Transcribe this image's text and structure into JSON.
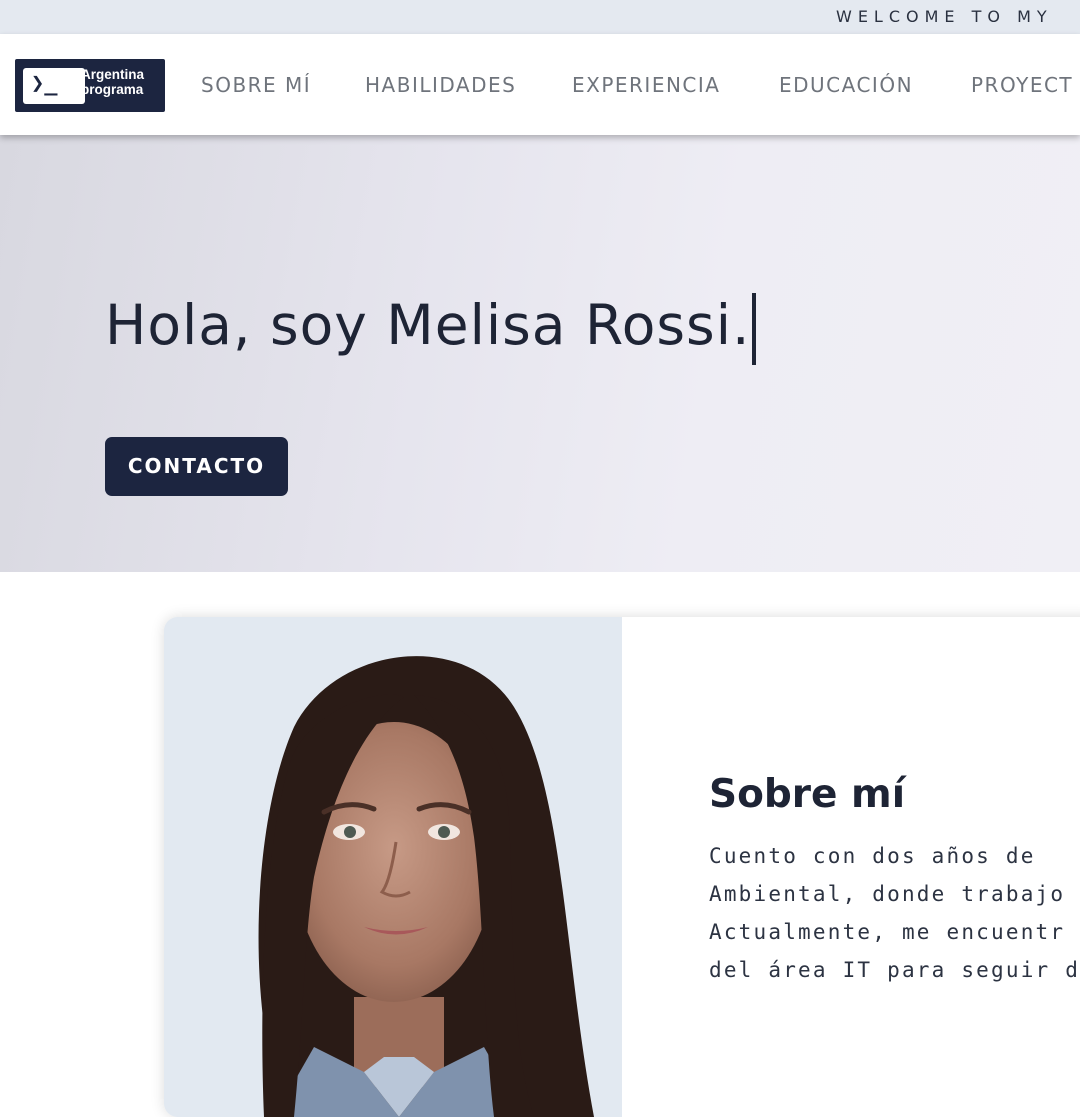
{
  "topbar": {
    "welcome_text": "WELCOME TO MY"
  },
  "nav": {
    "logo": {
      "line1": "Argentina",
      "line2": "programa",
      "glyph": "❯_",
      "icon": "terminal-icon"
    },
    "items": [
      {
        "label": "SOBRE MÍ"
      },
      {
        "label": "HABILIDADES"
      },
      {
        "label": "EXPERIENCIA"
      },
      {
        "label": "EDUCACIÓN"
      },
      {
        "label": "PROYECT"
      }
    ]
  },
  "hero": {
    "title": "Hola, soy Melisa Rossi.",
    "contact_label": "CONTACTO"
  },
  "about": {
    "title": "Sobre mí",
    "lines": [
      "Cuento con dos años de",
      "Ambiental, donde trabajo",
      "Actualmente, me encuentr",
      "del área IT para seguir desa"
    ]
  },
  "colors": {
    "navy": "#1c2540",
    "nav_text": "#6f747c",
    "topbar_bg": "#e4e9f0"
  }
}
